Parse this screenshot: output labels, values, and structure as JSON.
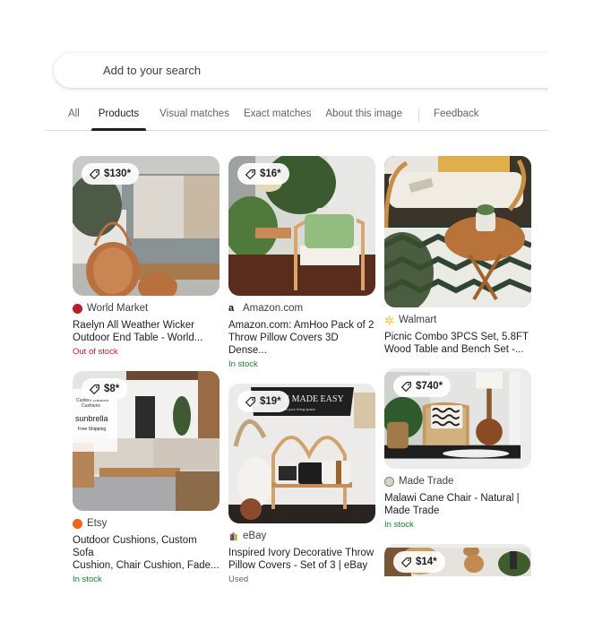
{
  "search": {
    "placeholder": "Add to your search"
  },
  "tabs": [
    {
      "label": "All",
      "active": false
    },
    {
      "label": "Products",
      "active": true
    },
    {
      "label": "Visual matches",
      "active": false
    },
    {
      "label": "Exact matches",
      "active": false
    },
    {
      "label": "About this image",
      "active": false
    },
    {
      "label": "Feedback",
      "active": false
    }
  ],
  "products": [
    {
      "price": "$130*",
      "source": "World Market",
      "source_icon": "world-market-logo-icon",
      "title_line1": "Raelyn All Weather Wicker",
      "title_line2": "Outdoor End Table - World...",
      "stock": "Out of stock",
      "image": "wicker-lantern-and-gray-sofa"
    },
    {
      "price": "$16*",
      "source": "Amazon.com",
      "source_icon": "amazon-logo-icon",
      "title_line1": "Amazon.com: AmHoo Pack of 2",
      "title_line2": "Throw Pillow Covers 3D Dense...",
      "stock": "In stock",
      "image": "rattan-chair-with-green-pillow"
    },
    {
      "price": "",
      "source": "Walmart",
      "source_icon": "walmart-spark-icon",
      "title_line1": "Picnic Combo 3PCS Set, 5.8FT",
      "title_line2": "Wood Table and Bench Set -...",
      "stock": "",
      "image": "rattan-sofa-and-wood-table"
    },
    {
      "price": "$8*",
      "source": "Etsy",
      "source_icon": "etsy-logo-icon",
      "title_line1": "Outdoor Cushions, Custom Sofa",
      "title_line2": "Cushion, Chair Cushion, Fade...",
      "stock": "In stock",
      "image": "outdoor-patio-sunbrella",
      "overlay_text": [
        "Custom Outdoor",
        "Cushions",
        "sunbrella",
        "Free Shipping"
      ]
    },
    {
      "price": "$19*",
      "source": "eBay",
      "source_icon": "ebay-bag-icon",
      "title_line1": "Inspired Ivory Decorative Throw",
      "title_line2": "Pillow Covers - Set of 3 | eBay",
      "stock": "Used",
      "image": "rattan-bench-with-pillows",
      "overlay_text": [
        "E MADE EASY",
        "form your living space"
      ]
    },
    {
      "price": "$740*",
      "source": "Made Trade",
      "source_icon": "made-trade-logo-icon",
      "title_line1": "Malawi Cane Chair - Natural |",
      "title_line2": "Made Trade",
      "stock": "In stock",
      "image": "cane-chair-and-lamp"
    },
    {
      "price": "$14*",
      "source": "",
      "title_line1": "",
      "title_line2": "",
      "stock": "",
      "image": "woven-wall-baskets"
    }
  ],
  "colors": {
    "in_stock": "#188038",
    "out_of_stock": "#c5221f",
    "text_primary": "#202124",
    "text_secondary": "#5f6368"
  }
}
